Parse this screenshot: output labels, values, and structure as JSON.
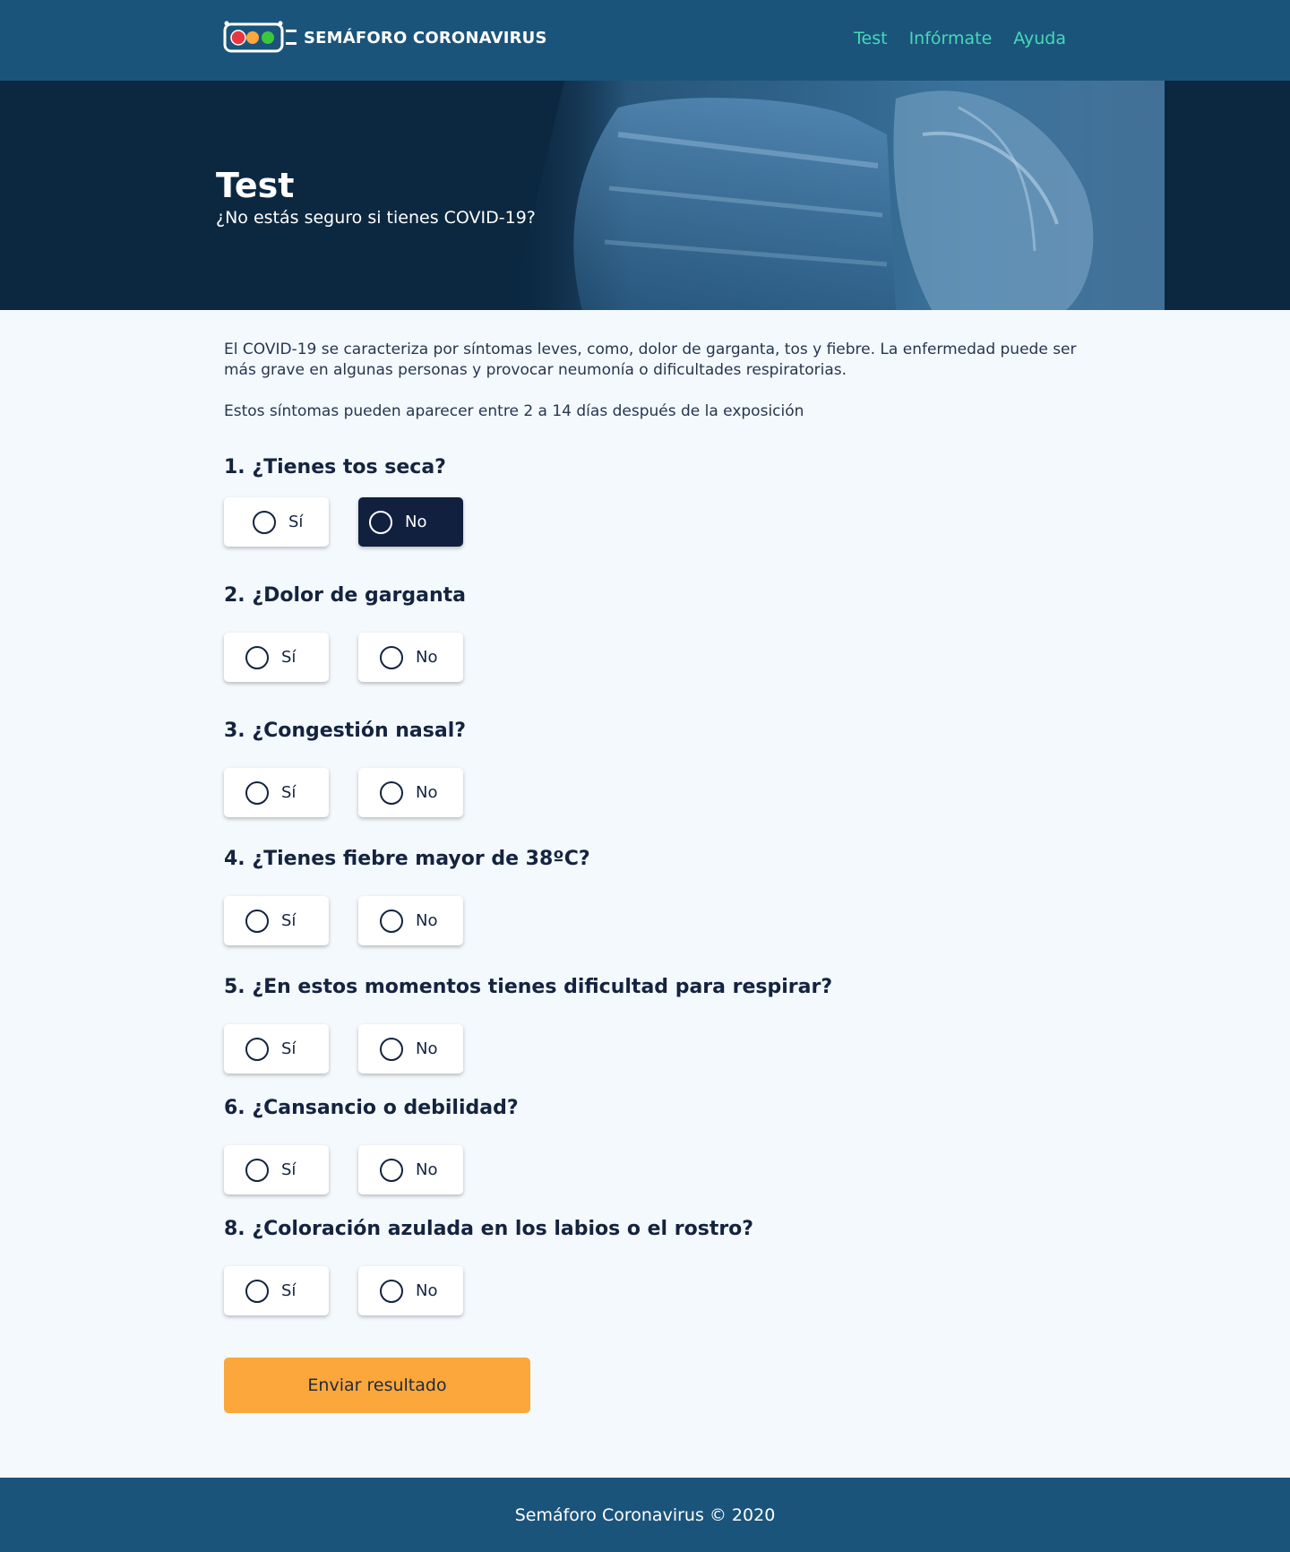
{
  "header": {
    "brand": "SEMÁFORO CORONAVIRUS",
    "nav": [
      "Test",
      "Infórmate",
      "Ayuda"
    ]
  },
  "hero": {
    "title": "Test",
    "subtitle": "¿No estás seguro si tienes COVID-19?"
  },
  "intro": {
    "p1": "El COVID-19 se caracteriza por síntomas leves, como, dolor de garganta, tos y fiebre. La enfermedad puede ser más grave en algunas personas y provocar neumonía o dificultades respiratorias.",
    "p2": "Estos síntomas pueden aparecer entre 2 a 14 días después de la exposición"
  },
  "questions": [
    {
      "title": "1. ¿Tienes tos seca?",
      "yes": "Sí",
      "no": "No",
      "selected": "no"
    },
    {
      "title": "2. ¿Dolor de garganta",
      "yes": "Sí",
      "no": "No",
      "selected": null
    },
    {
      "title": "3. ¿Congestión nasal?",
      "yes": "Sí",
      "no": "No",
      "selected": null
    },
    {
      "title": "4. ¿Tienes fiebre mayor de 38ºC?",
      "yes": "Sí",
      "no": "No",
      "selected": null
    },
    {
      "title": "5. ¿En estos momentos tienes dificultad para respirar?",
      "yes": "Sí",
      "no": "No",
      "selected": null
    },
    {
      "title": "6. ¿Cansancio o debilidad?",
      "yes": "Sí",
      "no": "No",
      "selected": null
    },
    {
      "title": "8. ¿Coloración azulada en los labios o el rostro?",
      "yes": "Sí",
      "no": "No",
      "selected": null
    }
  ],
  "submit_label": "Enviar resultado",
  "footer": "Semáforo Coronavirus © 2020",
  "colors": {
    "header_bg": "#1b547b",
    "nav_link": "#48d8b8",
    "selected_option": "#10203e",
    "submit": "#fba73b"
  }
}
